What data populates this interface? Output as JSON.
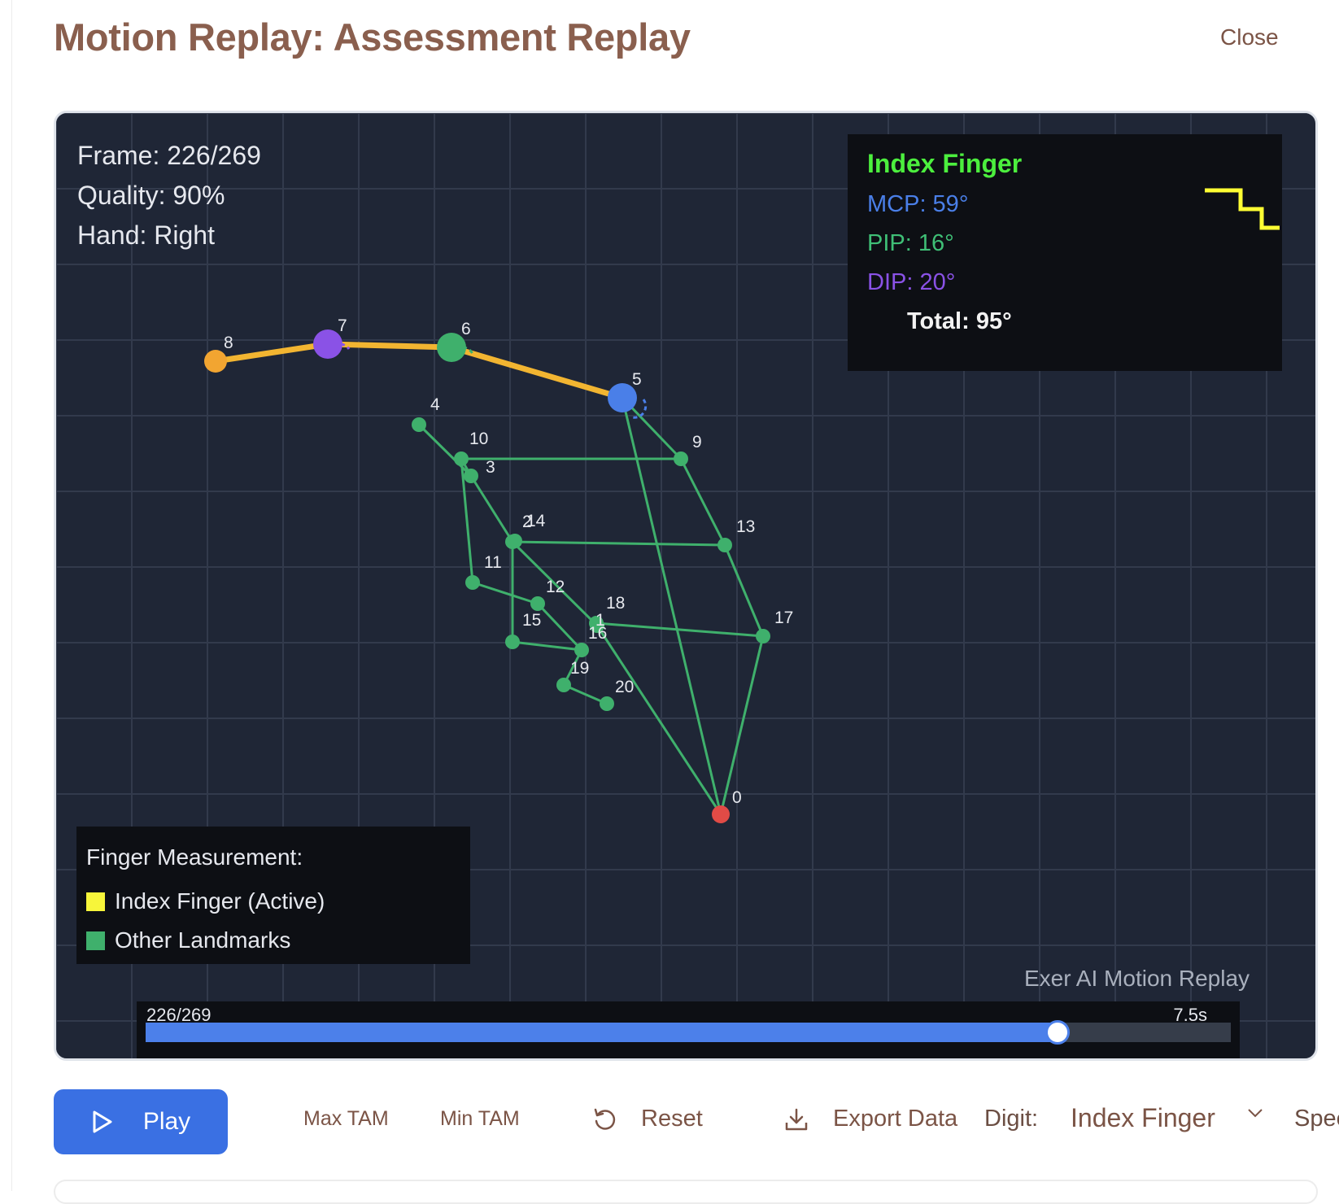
{
  "page": {
    "title": "Motion Replay: Assessment Replay",
    "close_label": "Close"
  },
  "viewer": {
    "info": {
      "frame": "Frame: 226/269",
      "quality": "Quality: 90%",
      "hand": "Hand: Right"
    },
    "angles": {
      "finger": "Index Finger",
      "mcp": "MCP: 59°",
      "pip": "PIP: 16°",
      "dip": "DIP: 20°",
      "total": "Total: 95°"
    },
    "legend": {
      "title": "Finger Measurement:",
      "active": {
        "label": "Index Finger (Active)",
        "color": "#f7f53a"
      },
      "other": {
        "label": "Other Landmarks",
        "color": "#3fb06c"
      }
    },
    "watermark": "Exer AI Motion Replay",
    "timeline": {
      "count": "226/269",
      "time": "7.5s",
      "progress": 0.84
    },
    "colors": {
      "active_line": "#f2b531",
      "bone": "#3fb06c",
      "wrist": "#e14b46",
      "mcp": "#4a7fe8",
      "pip": "#3fb06c",
      "dip": "#8a52e6",
      "tip": "#f2a531",
      "step_icon": "#ffff33"
    },
    "landmark_labels": [
      "0",
      "1",
      "2",
      "3",
      "4",
      "5",
      "6",
      "7",
      "8",
      "9",
      "10",
      "11",
      "12",
      "13",
      "14",
      "15",
      "16",
      "17",
      "18",
      "19",
      "20"
    ],
    "icons": {
      "step": "angle-step-icon"
    }
  },
  "controls": {
    "play_label": "Play",
    "max_tam_label": "Max TAM",
    "min_tam_label": "Min TAM",
    "reset_label": "Reset",
    "export_label": "Export Data",
    "digit_label": "Digit:",
    "digit_value": "Index Finger",
    "speed_label": "Speed"
  }
}
